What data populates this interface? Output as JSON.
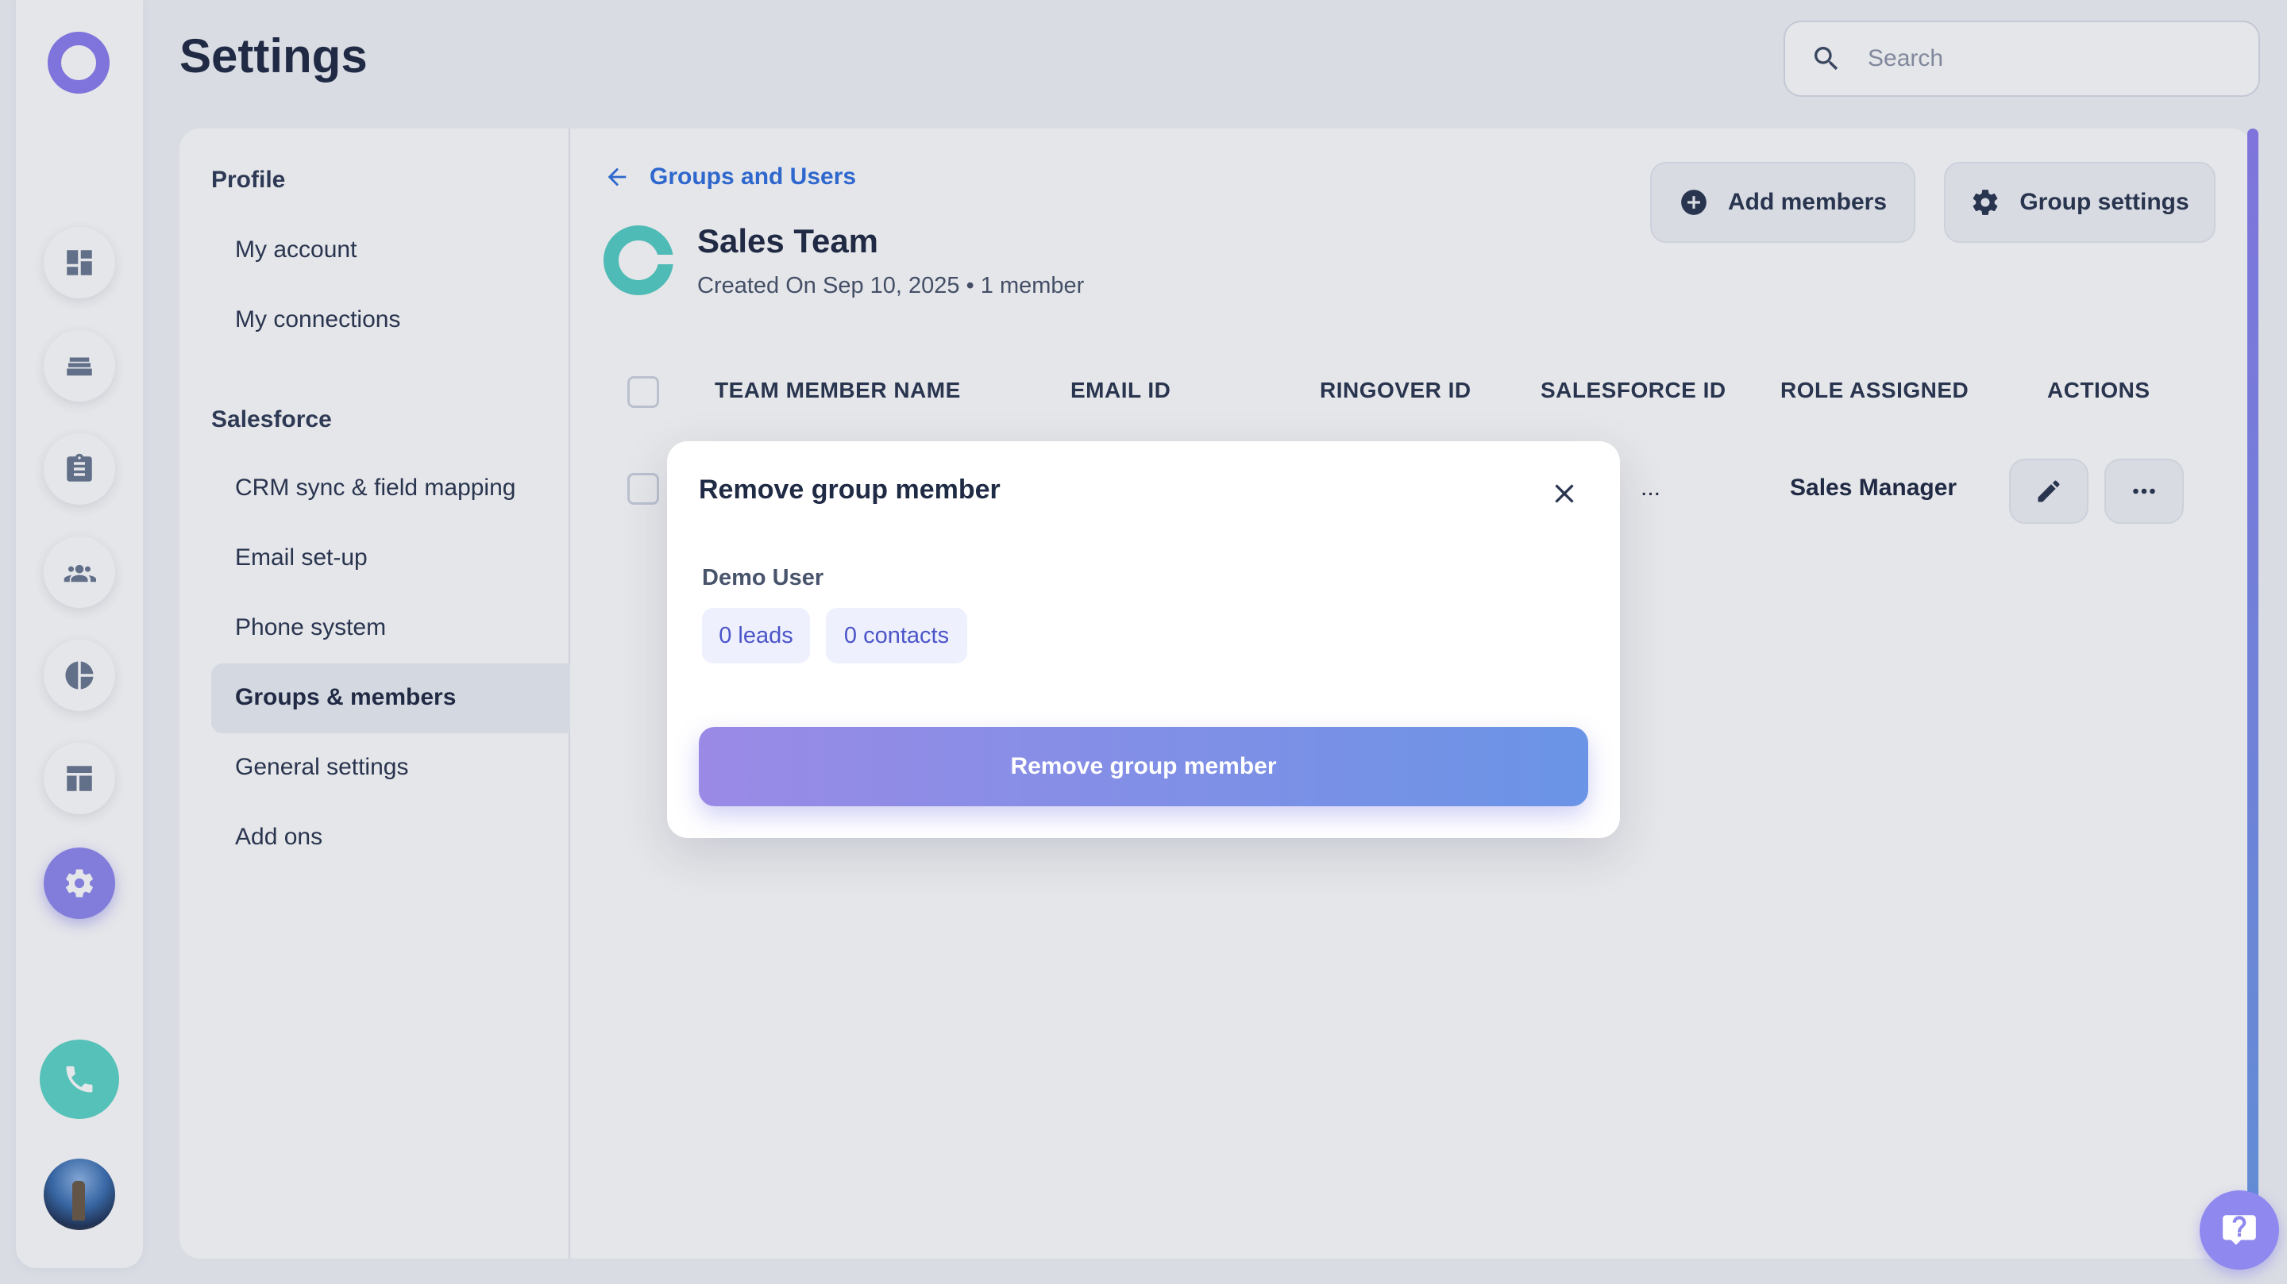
{
  "app": {
    "page_title": "Settings",
    "accent": "#8f88ef"
  },
  "search": {
    "placeholder": "Search",
    "value": ""
  },
  "rail": {
    "items": [
      {
        "icon": "dashboard-icon"
      },
      {
        "icon": "stack-icon"
      },
      {
        "icon": "clipboard-icon"
      },
      {
        "icon": "team-icon"
      },
      {
        "icon": "pie-chart-icon"
      },
      {
        "icon": "layout-icon"
      },
      {
        "icon": "settings-icon",
        "active": true
      }
    ]
  },
  "settings_nav": {
    "profile_heading": "Profile",
    "profile_items": [
      "My account",
      "My connections"
    ],
    "salesforce_heading": "Salesforce",
    "salesforce_items": [
      "CRM sync & field mapping",
      "Email set-up",
      "Phone system",
      "Groups & members",
      "General settings",
      "Add ons"
    ],
    "active_item": "Groups & members"
  },
  "group": {
    "back_label": "Groups and Users",
    "name": "Sales Team",
    "meta": "Created On Sep 10, 2025 • 1 member",
    "add_members_label": "Add members",
    "group_settings_label": "Group settings"
  },
  "table": {
    "headers": [
      "TEAM MEMBER NAME",
      "EMAIL ID",
      "RINGOVER ID",
      "SALESFORCE ID",
      "ROLE ASSIGNED",
      "ACTIONS"
    ],
    "rows": [
      {
        "salesforce_id": "...",
        "role": "Sales Manager"
      }
    ]
  },
  "modal": {
    "title": "Remove group member",
    "user_name": "Demo User",
    "leads": "0 leads",
    "contacts": "0 contacts",
    "action_label": "Remove group member"
  }
}
